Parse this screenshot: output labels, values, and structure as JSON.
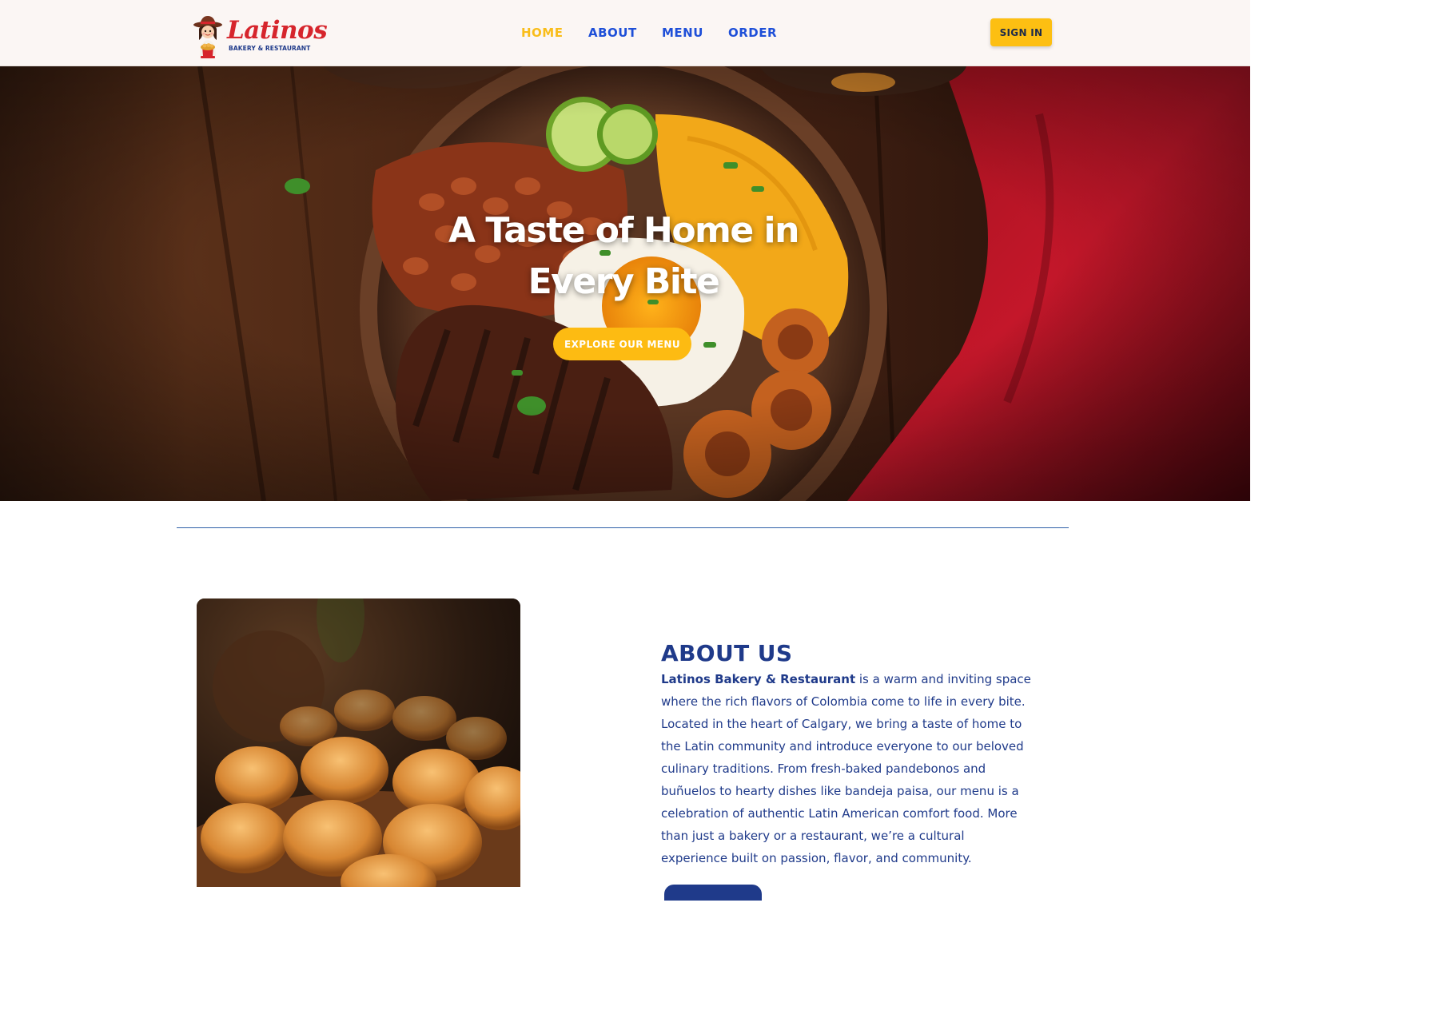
{
  "header": {
    "logo": {
      "word": "Latinos",
      "subtitle": "BAKERY & RESTAURANT"
    },
    "nav": [
      {
        "label": "HOME",
        "active": true
      },
      {
        "label": "ABOUT",
        "active": false
      },
      {
        "label": "MENU",
        "active": false
      },
      {
        "label": "ORDER",
        "active": false
      }
    ],
    "signin_label": "SIGN IN"
  },
  "hero": {
    "title_line1": "A Taste of Home in",
    "title_line2": "Every Bite",
    "cta_label": "EXPLORE OUR MENU"
  },
  "about": {
    "title": "ABOUT US",
    "brand": "Latinos Bakery & Restaurant",
    "body": " is a warm and inviting space where the rich flavors of Colombia come to life in every bite. Located in the heart of Calgary, we bring a taste of home to the Latin community and introduce everyone to our beloved culinary traditions. From fresh-baked pandebonos and buñuelos to hearty dishes like bandeja paisa, our menu is a celebration of authentic Latin American comfort food. More than just a bakery or a restaurant, we’re a cultural experience built on passion, flavor, and community."
  },
  "colors": {
    "accent_yellow": "#fdbb12",
    "brand_blue": "#1f3a8a",
    "nav_blue": "#1e4fd8",
    "logo_red": "#d6252c",
    "header_bg": "#fbf6f4"
  },
  "icons": {
    "logo_mascot": "cowgirl-baker-mascot-icon"
  }
}
